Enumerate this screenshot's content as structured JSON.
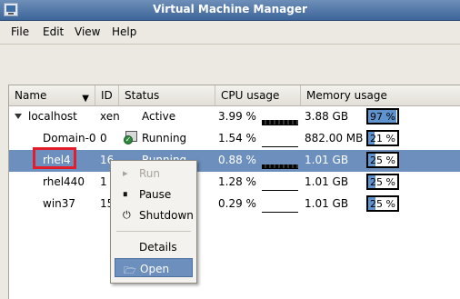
{
  "window": {
    "title": "Virtual Machine Manager"
  },
  "menubar": [
    {
      "label": "File"
    },
    {
      "label": "Edit"
    },
    {
      "label": "View"
    },
    {
      "label": "Help"
    }
  ],
  "table": {
    "columns": [
      "Name",
      "ID",
      "Status",
      "CPU usage",
      "Memory usage"
    ],
    "rows": [
      {
        "name": "localhost",
        "id": "xen",
        "status": "Active",
        "cpu": "3.99 %",
        "mem": "3.88 GB",
        "mem_pct": "97 %",
        "mem_fraction": 0.97
      },
      {
        "name": "Domain-0",
        "id": "0",
        "status": "Running",
        "cpu": "1.54 %",
        "mem": "882.00 MB",
        "mem_pct": "21 %",
        "mem_fraction": 0.21
      },
      {
        "name": "rhel4",
        "id": "16",
        "status": "Running",
        "cpu": "0.88 %",
        "mem": "1.01 GB",
        "mem_pct": "25 %",
        "mem_fraction": 0.25
      },
      {
        "name": "rhel440",
        "id": "1",
        "status": "",
        "cpu": "1.28 %",
        "mem": "1.01 GB",
        "mem_pct": "25 %",
        "mem_fraction": 0.25
      },
      {
        "name": "win37",
        "id": "15",
        "status": "",
        "cpu": "0.29 %",
        "mem": "1.01 GB",
        "mem_pct": "25 %",
        "mem_fraction": 0.25
      }
    ]
  },
  "context_menu": [
    {
      "label": "Run",
      "icon": "play-icon",
      "disabled": true
    },
    {
      "label": "Pause",
      "icon": "pause-icon"
    },
    {
      "label": "Shutdown",
      "icon": "power-icon"
    },
    {
      "label": "Details"
    },
    {
      "label": "Open",
      "icon": "folder-open-icon",
      "active": true
    }
  ],
  "colors": {
    "selection": "#6d8fbd",
    "memory_bar": "#5f93cf",
    "highlight": "#e21e2d"
  }
}
